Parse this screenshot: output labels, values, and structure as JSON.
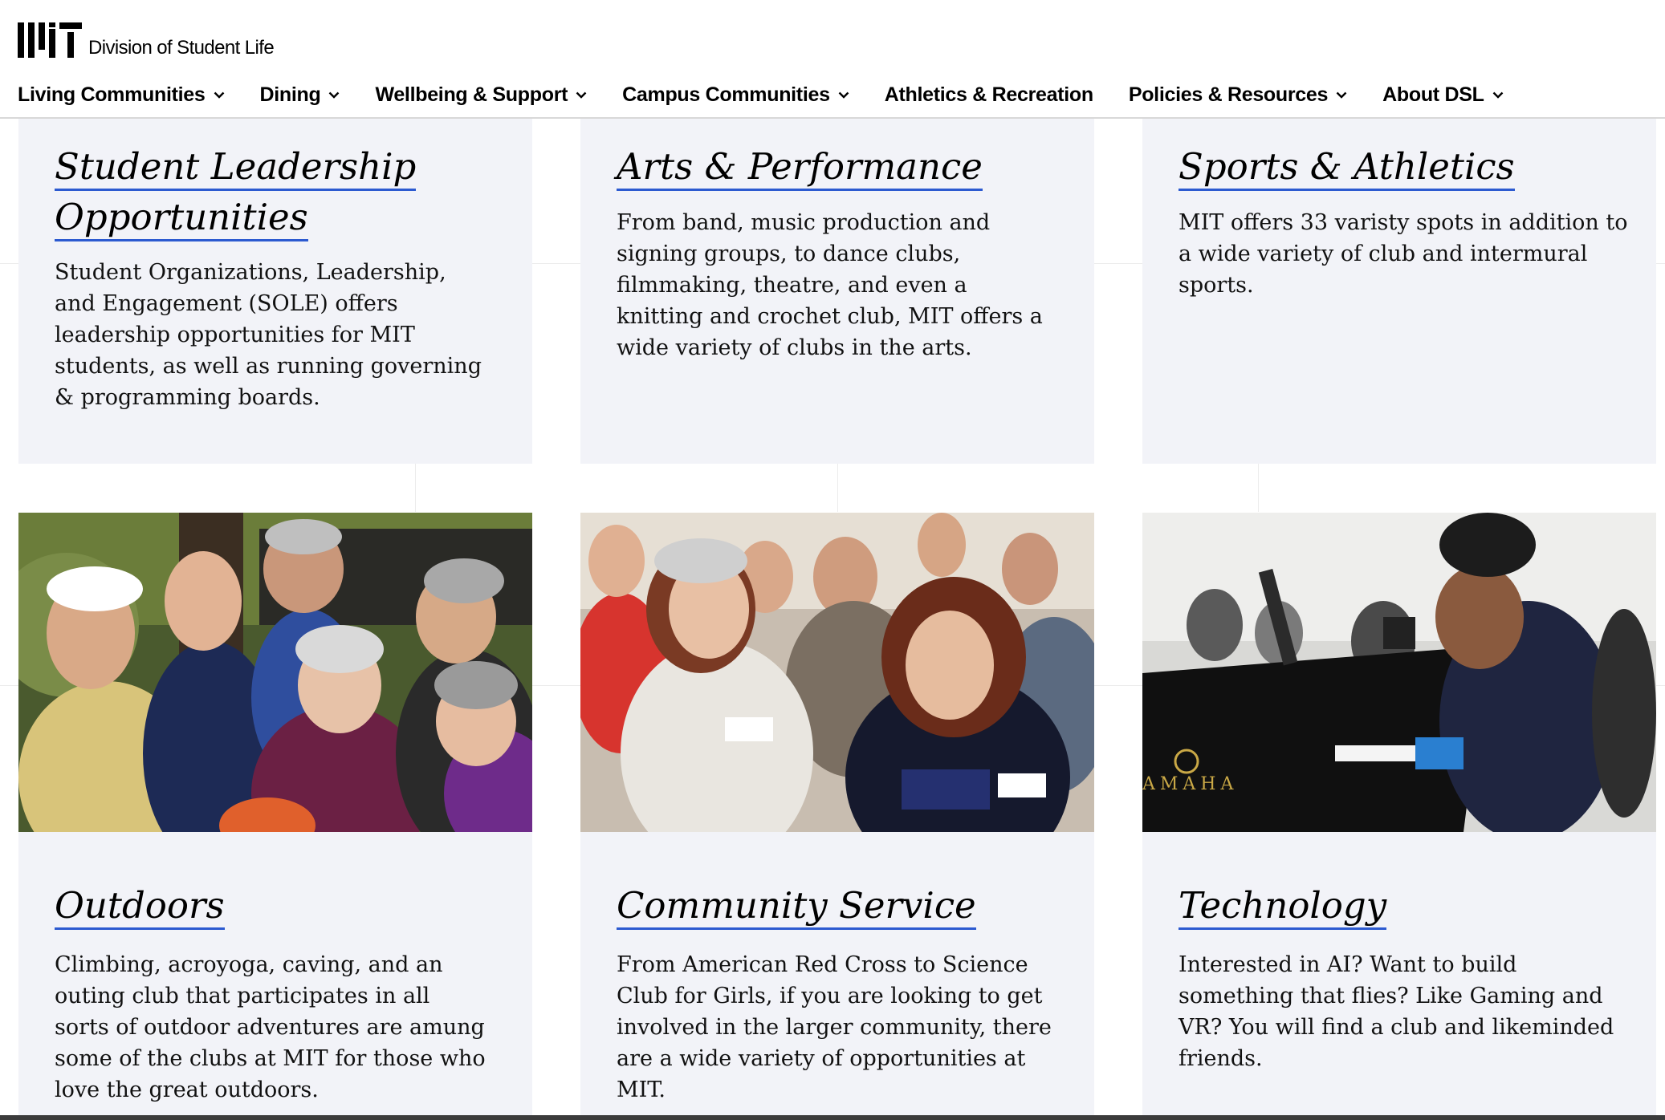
{
  "brand": {
    "logo": "MIT",
    "name": "Division of Student Life"
  },
  "nav": {
    "items": [
      {
        "label": "Living Communities",
        "has_dropdown": true
      },
      {
        "label": "Dining",
        "has_dropdown": true
      },
      {
        "label": "Wellbeing & Support",
        "has_dropdown": true
      },
      {
        "label": "Campus Communities",
        "has_dropdown": true
      },
      {
        "label": "Athletics & Recreation",
        "has_dropdown": false
      },
      {
        "label": "Policies & Resources",
        "has_dropdown": true
      },
      {
        "label": "About DSL",
        "has_dropdown": true
      }
    ]
  },
  "cards": {
    "leadership": {
      "title_line1": "Student Leadership",
      "title_line2": "Opportunities",
      "description": "Student Organizations, Leadership, and Engagement (SOLE) offers leadership opportunities for MIT students, as well as running governing & programming boards."
    },
    "arts": {
      "title": "Arts & Performance",
      "description": "From band, music production and signing groups, to dance clubs, filmmaking, theatre, and even a knitting and crochet club, MIT offers a wide variety of clubs in the arts."
    },
    "sports": {
      "title": "Sports & Athletics",
      "description": "MIT offers 33 varisty spots in addition to a wide variety of club and intermural sports."
    },
    "outdoors": {
      "title": "Outdoors",
      "description": "Climbing, acroyoga, caving, and an outing club that participates in all sorts of outdoor adventures are amung some of the clubs at MIT for those who love the great outdoors."
    },
    "community": {
      "title": "Community Service",
      "description": "From American Red Cross to Science Club for Girls, if you are looking to get involved in the larger community, there are a wide variety of opportunities at MIT."
    },
    "technology": {
      "title": "Technology",
      "description": "Interested in AI? Want to build something that flies? Like Gaming and VR? You will find a club and likeminded friends."
    }
  },
  "photos": {
    "tech_piano_brand": "AMAHA"
  },
  "colors": {
    "card_bg": "#f2f3f8",
    "link_underline": "#2c5ad0"
  }
}
